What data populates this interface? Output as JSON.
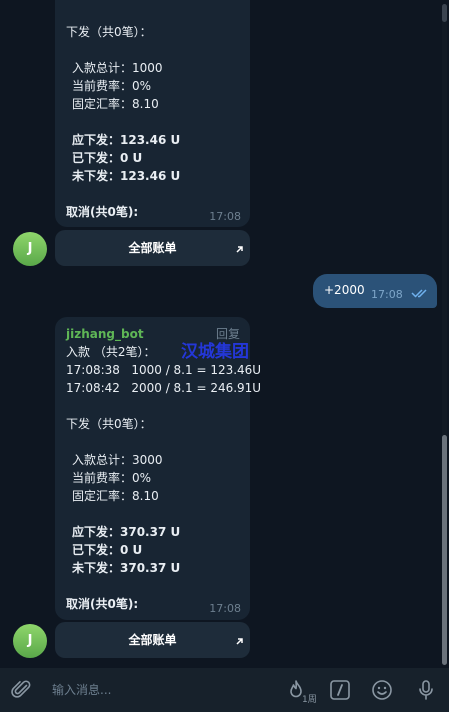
{
  "messages": {
    "first": {
      "issue_header": "下发（共0笔）：",
      "income_total": "入款总计：1000",
      "fee_rate": "当前费率：0%",
      "fx_rate": "固定汇率：8.10",
      "should_issue": "应下发：123.46 U",
      "issued": "已下发：0 U",
      "not_issued": "未下发：123.46 U",
      "cancel": "取消(共0笔):",
      "time": "17:08",
      "button_label": "全部账单"
    },
    "outgoing": {
      "text": "+2000",
      "time": "17:08"
    },
    "second": {
      "sender": "jizhang_bot",
      "reply": "回复",
      "income_header": "入款 （共2笔）：",
      "entries": [
        "17:08:38   1000 / 8.1 = 123.46U",
        "17:08:42   2000 / 8.1 = 246.91U"
      ],
      "issue_header": "下发（共0笔）：",
      "income_total": "入款总计：3000",
      "fee_rate": "当前费率：0%",
      "fx_rate": "固定汇率：8.10",
      "should_issue": "应下发：370.37 U",
      "issued": "已下发：0 U",
      "not_issued": "未下发：370.37 U",
      "cancel": "取消(共0笔):",
      "time": "17:08",
      "button_label": "全部账单"
    },
    "avatar_initial": "J",
    "watermark": "汉城集团"
  },
  "composer": {
    "placeholder": "输入消息...",
    "badge": "1周"
  },
  "icons": {
    "attach": "paperclip-icon",
    "timer": "fire-timer-icon",
    "commands": "slash-command-icon",
    "emoji": "emoji-icon",
    "mic": "microphone-icon",
    "read": "double-check-icon",
    "link_arrow": "arrow-up-right-icon"
  },
  "colors": {
    "background": "#0e1621",
    "incoming_bubble": "#182533",
    "outgoing_bubble": "#2b5278",
    "sender_name": "#5fb656",
    "avatar": "#6fbf55"
  }
}
